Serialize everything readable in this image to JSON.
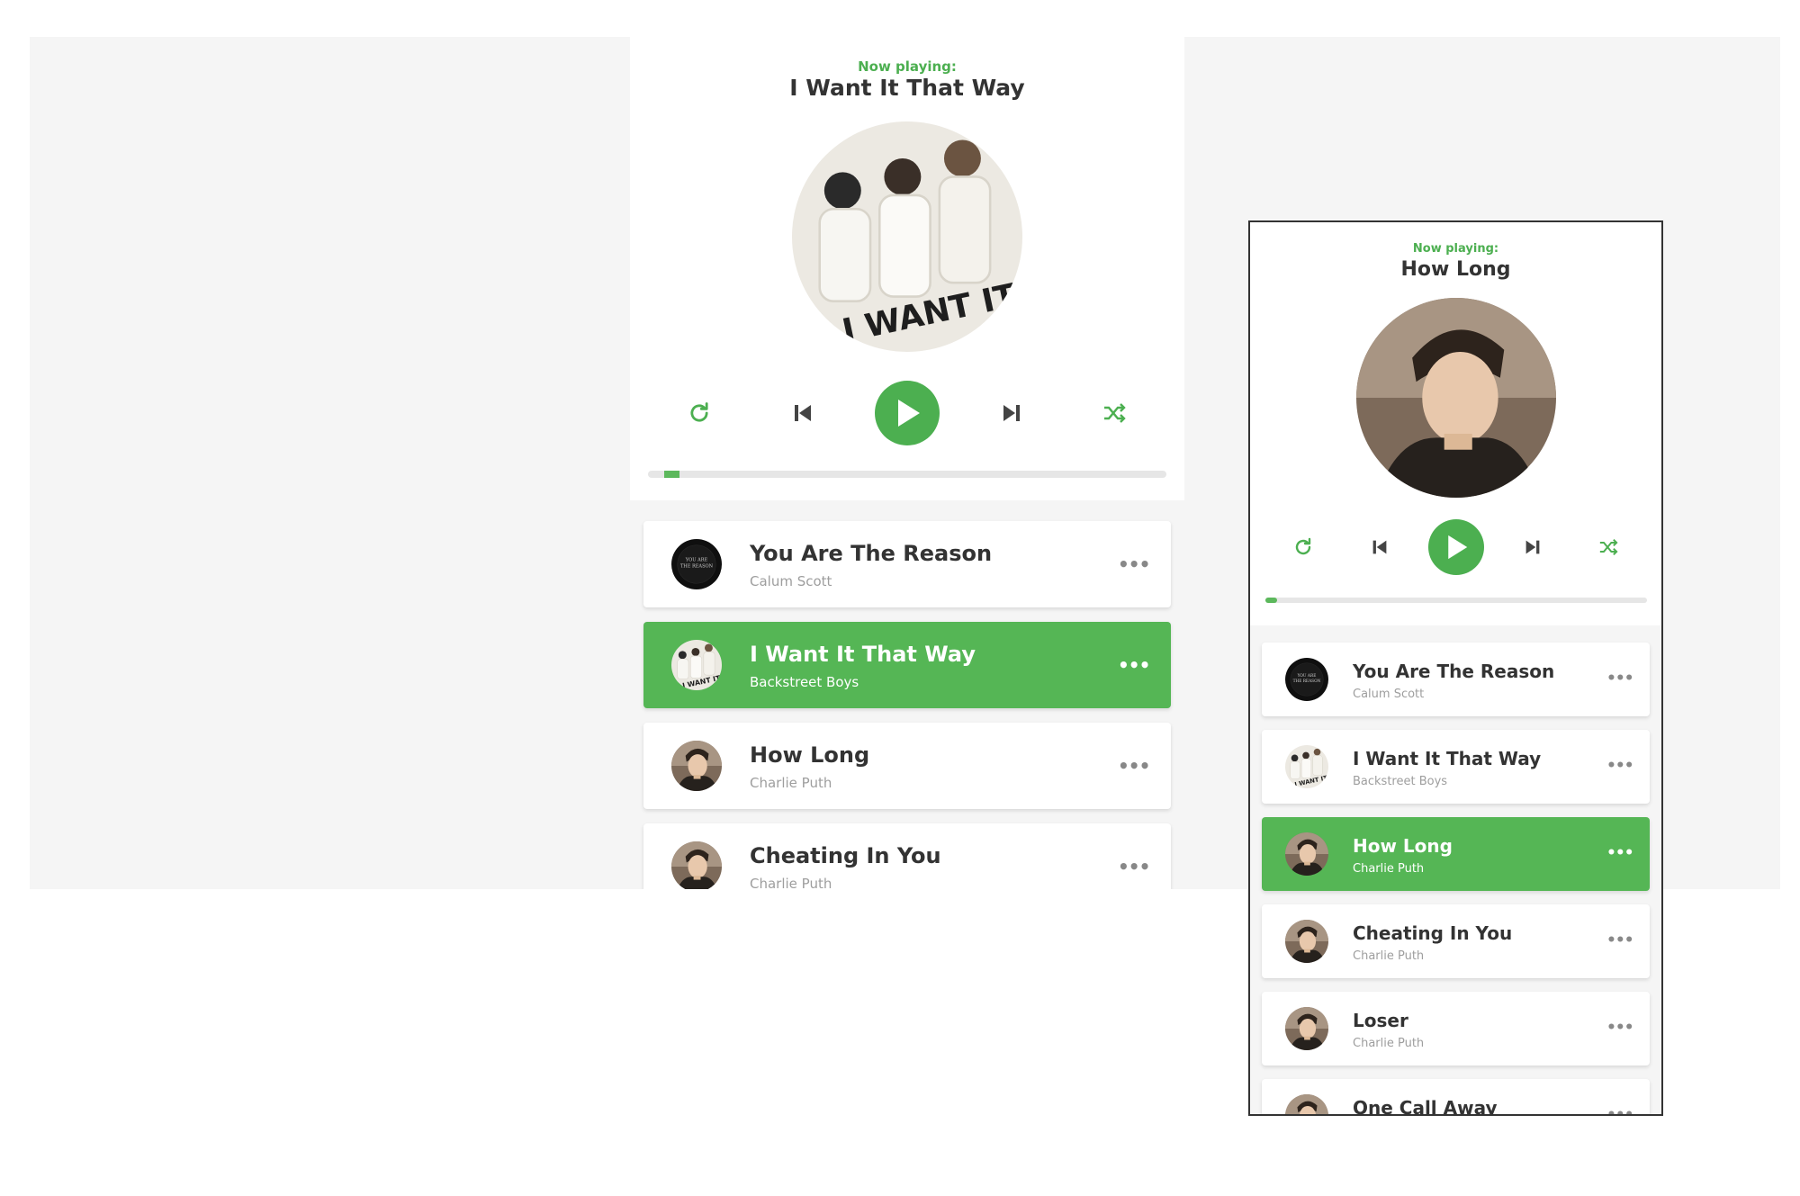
{
  "colors": {
    "accent": "#4caf50",
    "active_row": "#55b655",
    "stage_bg": "#f5f5f5",
    "card_bg": "#ffffff",
    "title_text": "#333333",
    "artist_text": "#9e9e9e"
  },
  "desktop": {
    "now_playing_label": "Now playing:",
    "now_playing_title": "I Want It That Way",
    "cover_art": "backstreet-boys-cover",
    "progress_fraction": 0.03,
    "controls": {
      "repeat_icon": "repeat-icon",
      "prev_icon": "skip-previous-icon",
      "play_icon": "play-icon",
      "next_icon": "skip-next-icon",
      "shuffle_icon": "shuffle-icon"
    },
    "playlist": [
      {
        "title": "You Are The Reason",
        "artist": "Calum Scott",
        "more": "•••",
        "active": false,
        "thumb": "calum-scott-cover"
      },
      {
        "title": "I Want It That Way",
        "artist": "Backstreet Boys",
        "more": "•••",
        "active": true,
        "thumb": "backstreet-boys-cover"
      },
      {
        "title": "How Long",
        "artist": "Charlie Puth",
        "more": "•••",
        "active": false,
        "thumb": "charlie-puth-cover"
      },
      {
        "title": "Cheating In You",
        "artist": "Charlie Puth",
        "more": "•••",
        "active": false,
        "thumb": "charlie-puth-cover"
      }
    ]
  },
  "mobile": {
    "now_playing_label": "Now playing:",
    "now_playing_title": "How Long",
    "cover_art": "charlie-puth-cover",
    "progress_fraction": 0.03,
    "controls": {
      "repeat_icon": "repeat-icon",
      "prev_icon": "skip-previous-icon",
      "play_icon": "play-icon",
      "next_icon": "skip-next-icon",
      "shuffle_icon": "shuffle-icon"
    },
    "playlist": [
      {
        "title": "You Are The Reason",
        "artist": "Calum Scott",
        "more": "•••",
        "active": false,
        "thumb": "calum-scott-cover"
      },
      {
        "title": "I Want It That Way",
        "artist": "Backstreet Boys",
        "more": "•••",
        "active": false,
        "thumb": "backstreet-boys-cover"
      },
      {
        "title": "How Long",
        "artist": "Charlie Puth",
        "more": "•••",
        "active": true,
        "thumb": "charlie-puth-cover"
      },
      {
        "title": "Cheating In You",
        "artist": "Charlie Puth",
        "more": "•••",
        "active": false,
        "thumb": "charlie-puth-cover"
      },
      {
        "title": "Loser",
        "artist": "Charlie Puth",
        "more": "•••",
        "active": false,
        "thumb": "charlie-puth-cover"
      },
      {
        "title": "One Call Away",
        "artist": "",
        "more": "•••",
        "active": false,
        "thumb": "charlie-puth-cover"
      }
    ]
  }
}
